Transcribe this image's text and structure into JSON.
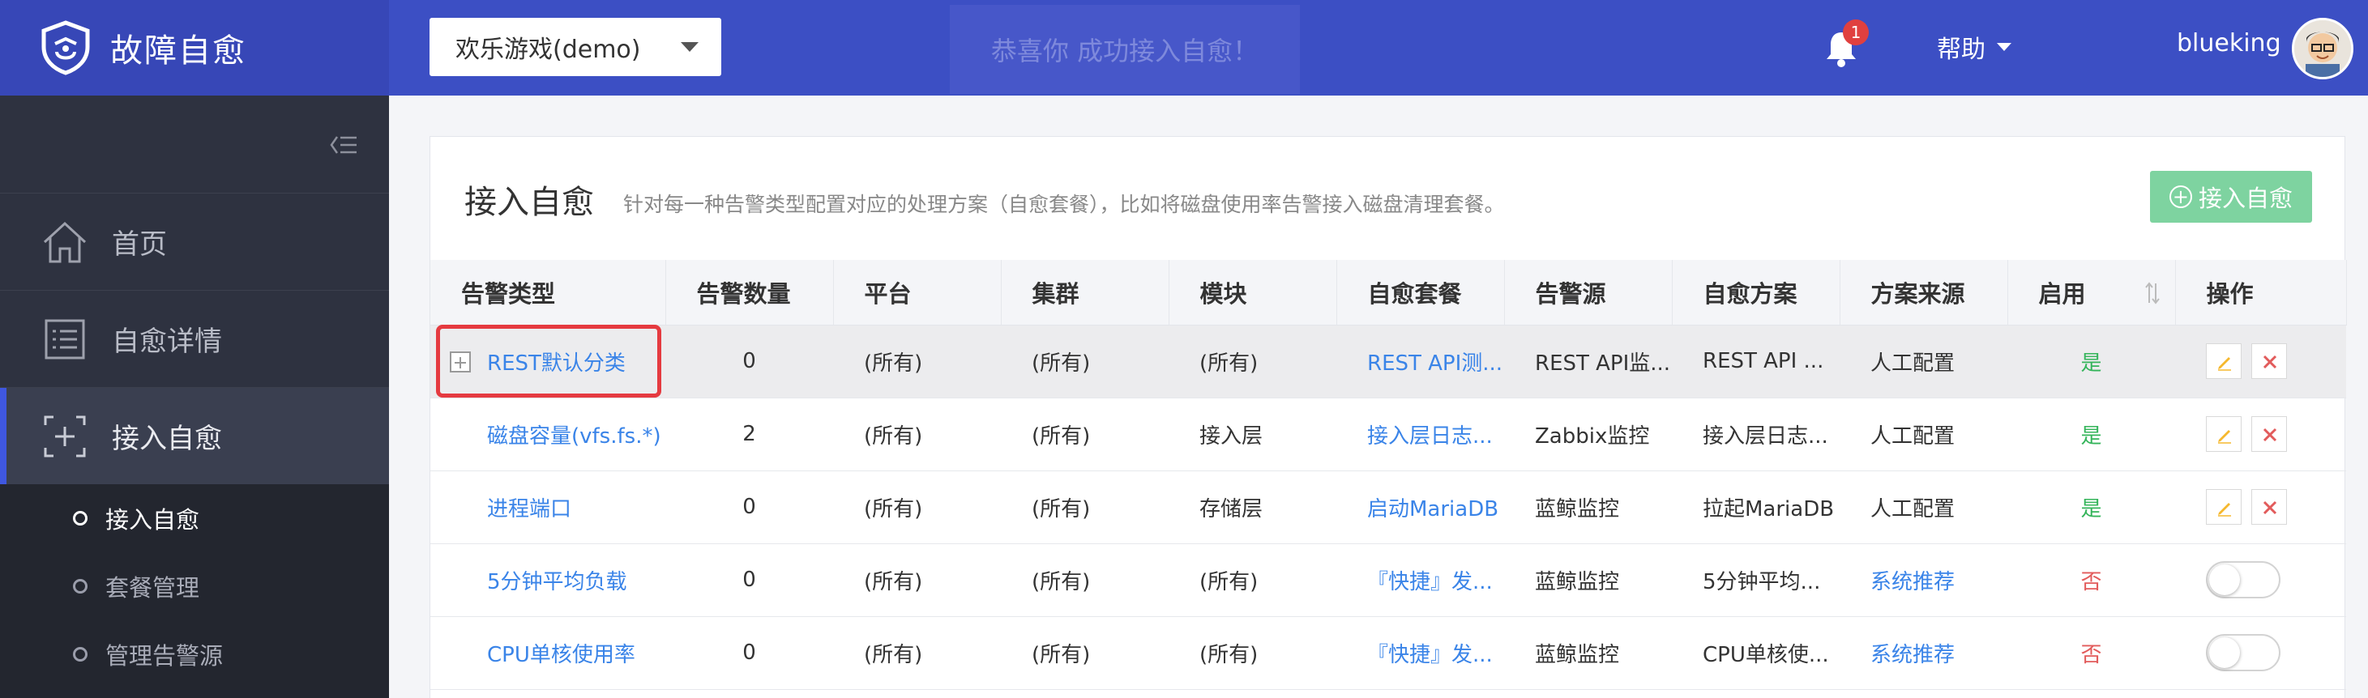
{
  "header": {
    "brand_title": "故障自愈",
    "biz_selected": "欢乐游戏(demo)",
    "toast_text": "恭喜你 成功接入自愈！",
    "notification_count": "1",
    "help_label": "帮助",
    "username": "blueking"
  },
  "sidebar": {
    "items": [
      {
        "label": "首页",
        "icon": "home-icon"
      },
      {
        "label": "自愈详情",
        "icon": "list-icon"
      },
      {
        "label": "接入自愈",
        "icon": "plus-square-icon"
      }
    ],
    "subitems": [
      {
        "label": "接入自愈"
      },
      {
        "label": "套餐管理"
      },
      {
        "label": "管理告警源"
      }
    ]
  },
  "panel": {
    "title": "接入自愈",
    "description": "针对每一种告警类型配置对应的处理方案（自愈套餐），比如将磁盘使用率告警接入磁盘清理套餐。",
    "add_button": "接入自愈"
  },
  "table": {
    "columns": [
      "告警类型",
      "告警数量",
      "平台",
      "集群",
      "模块",
      "自愈套餐",
      "告警源",
      "自愈方案",
      "方案来源",
      "启用",
      "操作"
    ],
    "rows": [
      {
        "type": "REST默认分类",
        "count": "0",
        "platform": "(所有)",
        "cluster": "(所有)",
        "module": "(所有)",
        "package": "REST API测...",
        "source": "REST API监...",
        "scheme": "REST API ...",
        "origin": "人工配置",
        "enabled": "是",
        "enabled_on": true
      },
      {
        "type": "磁盘容量(vfs.fs.*)",
        "count": "2",
        "platform": "(所有)",
        "cluster": "(所有)",
        "module": "接入层",
        "package": "接入层日志...",
        "source": "Zabbix监控",
        "scheme": "接入层日志...",
        "origin": "人工配置",
        "enabled": "是",
        "enabled_on": true
      },
      {
        "type": "进程端口",
        "count": "0",
        "platform": "(所有)",
        "cluster": "(所有)",
        "module": "存储层",
        "package": "启动MariaDB",
        "source": "蓝鲸监控",
        "scheme": "拉起MariaDB",
        "origin": "人工配置",
        "enabled": "是",
        "enabled_on": true
      },
      {
        "type": "5分钟平均负载",
        "count": "0",
        "platform": "(所有)",
        "cluster": "(所有)",
        "module": "(所有)",
        "package": "『快捷』发...",
        "source": "蓝鲸监控",
        "scheme": "5分钟平均...",
        "origin": "系统推荐",
        "enabled": "否",
        "enabled_on": false
      },
      {
        "type": "CPU单核使用率",
        "count": "0",
        "platform": "(所有)",
        "cluster": "(所有)",
        "module": "(所有)",
        "package": "『快捷』发...",
        "source": "蓝鲸监控",
        "scheme": "CPU单核使...",
        "origin": "系统推荐",
        "enabled": "否",
        "enabled_on": false
      }
    ]
  },
  "colors": {
    "header_bg": "#3c4fc4",
    "sidebar_bg": "#2e3240",
    "link": "#3a84e8",
    "yes": "#34b45a",
    "no": "#e25b5b",
    "add_button": "#7ed3a0",
    "highlight": "#e53a40"
  }
}
